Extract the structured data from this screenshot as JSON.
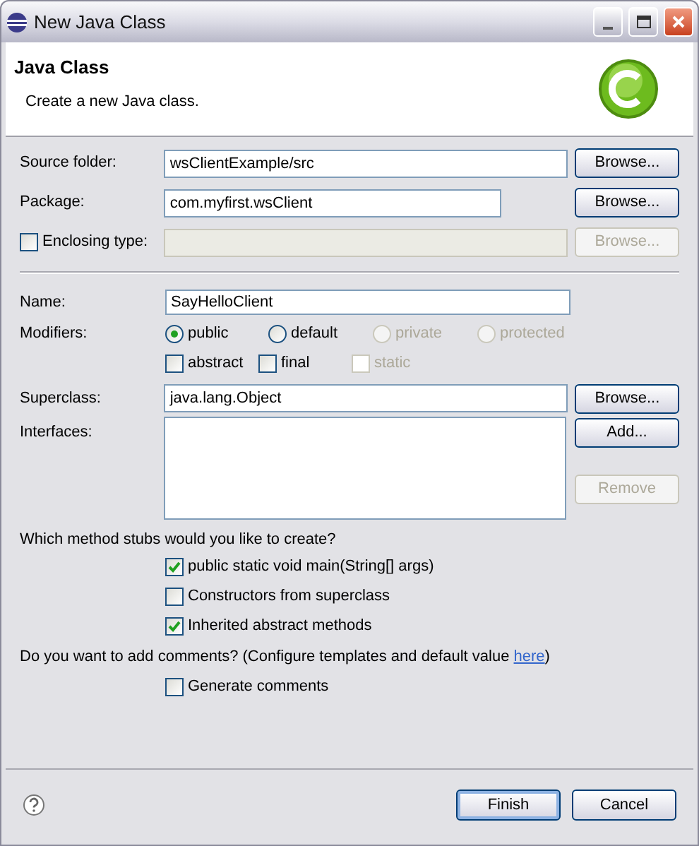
{
  "window": {
    "title": "New Java Class"
  },
  "header": {
    "title": "Java Class",
    "description": "Create a new Java class."
  },
  "location_rows": [
    {
      "kind": "field",
      "label": "Source folder:",
      "value": "wsClientExample/src",
      "disabled": false,
      "button": "Browse..."
    },
    {
      "kind": "field",
      "label": "Package:",
      "value": "com.myfirst.wsClient",
      "disabled": false,
      "button": "Browse..."
    },
    {
      "kind": "checkbox",
      "label": "Enclosing type:",
      "checked": false,
      "value_disabled": true,
      "disabled": true,
      "button": "Browse..."
    }
  ],
  "name": {
    "label": "Name:",
    "value": "SayHelloClient"
  },
  "modifiers": {
    "label": "Modifiers:",
    "radios": [
      {
        "label": "public",
        "selected": true,
        "disabled": false
      },
      {
        "label": "default",
        "selected": false,
        "disabled": false
      },
      {
        "label": "private",
        "selected": false,
        "disabled": true
      },
      {
        "label": "protected",
        "selected": false,
        "disabled": true
      }
    ],
    "checkboxes": [
      {
        "label": "abstract",
        "checked": false,
        "disabled": false
      },
      {
        "label": "final",
        "checked": false,
        "disabled": false
      },
      {
        "label": "static",
        "checked": false,
        "disabled": true
      }
    ]
  },
  "superclass": {
    "label": "Superclass:",
    "value": "java.lang.Object",
    "button": "Browse..."
  },
  "interfaces": {
    "label": "Interfaces:",
    "buttons": [
      {
        "label": "Add...",
        "disabled": false
      },
      {
        "label": "Remove",
        "disabled": true
      }
    ]
  },
  "stubs": {
    "question": "Which method stubs would you like to create?",
    "options": [
      {
        "label": "public static void main(String[] args)",
        "checked": true
      },
      {
        "label": "Constructors from superclass",
        "checked": false
      },
      {
        "label": "Inherited abstract methods",
        "checked": true
      }
    ]
  },
  "comments": {
    "question": "Do you want to add comments? (Configure templates and default value ",
    "link": "here",
    "suffix": ")",
    "options": [
      {
        "label": "Generate comments",
        "checked": false
      }
    ]
  },
  "footer_buttons": [
    {
      "label": "Finish",
      "default": true
    },
    {
      "label": "Cancel",
      "default": false
    }
  ]
}
